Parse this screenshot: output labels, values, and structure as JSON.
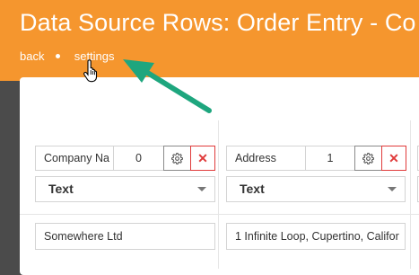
{
  "header": {
    "title": "Data Source Rows: Order Entry - Co",
    "breadcrumb": {
      "back": "back",
      "settings": "settings"
    }
  },
  "columns": [
    {
      "name": "Company Na",
      "order": "0",
      "type": "Text",
      "value": "Somewhere Ltd"
    },
    {
      "name": "Address",
      "order": "1",
      "type": "Text",
      "value": "1 Infinite Loop, Cupertino, Califor"
    }
  ],
  "icons": {
    "settings": "gear-icon",
    "delete": "close-icon",
    "dropdown": "chevron-down-icon",
    "cursor": "hand-pointer-icon",
    "annotation": "arrow-icon"
  },
  "colors": {
    "header": "#f5962e",
    "delete": "#e03b3b",
    "annotation_arrow": "#1ea67e"
  }
}
